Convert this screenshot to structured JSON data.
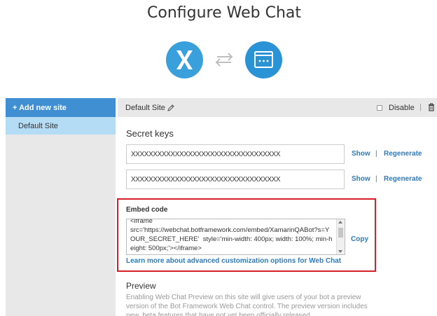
{
  "page": {
    "title": "Configure Web Chat"
  },
  "icons": {
    "left_logo": "xamarin-logo-icon",
    "exchange": "exchange-arrows-icon",
    "right_logo": "web-chat-window-icon",
    "edit": "pencil-icon",
    "delete": "trash-icon"
  },
  "colors": {
    "accent": "#3f8fd2",
    "selected_site": "#b5dcf5",
    "link": "#2b7bbf",
    "highlight_border": "#d61f26"
  },
  "sidebar": {
    "add_label": "+ Add new site",
    "items": [
      {
        "label": "Default Site"
      }
    ]
  },
  "header": {
    "site_name": "Default Site",
    "disable_label": "Disable",
    "disable_checked": false,
    "separator": "|"
  },
  "secret_keys": {
    "title": "Secret keys",
    "keys": [
      {
        "value": "XXXXXXXXXXXXXXXXXXXXXXXXXXXXXXXXXX",
        "show_label": "Show",
        "regenerate_label": "Regenerate"
      },
      {
        "value": "XXXXXXXXXXXXXXXXXXXXXXXXXXXXXXXXXX",
        "show_label": "Show",
        "regenerate_label": "Regenerate"
      }
    ],
    "separator": "|"
  },
  "embed": {
    "title": "Embed code",
    "code": "<iframe\nsrc='https://webchat.botframework.com/embed/XamarinQABot?s=YOUR_SECRET_HERE'  style='min-width: 400px; width: 100%; min-height: 500px;'></iframe>",
    "copy_label": "Copy",
    "learn_more": "Learn more about advanced customization options for Web Chat"
  },
  "preview": {
    "title": "Preview",
    "description": "Enabling Web Chat Preview on this site will give users of your bot a preview version of the Bot Framework Web Chat control. The preview version includes new, beta features that have not yet been officially released."
  }
}
